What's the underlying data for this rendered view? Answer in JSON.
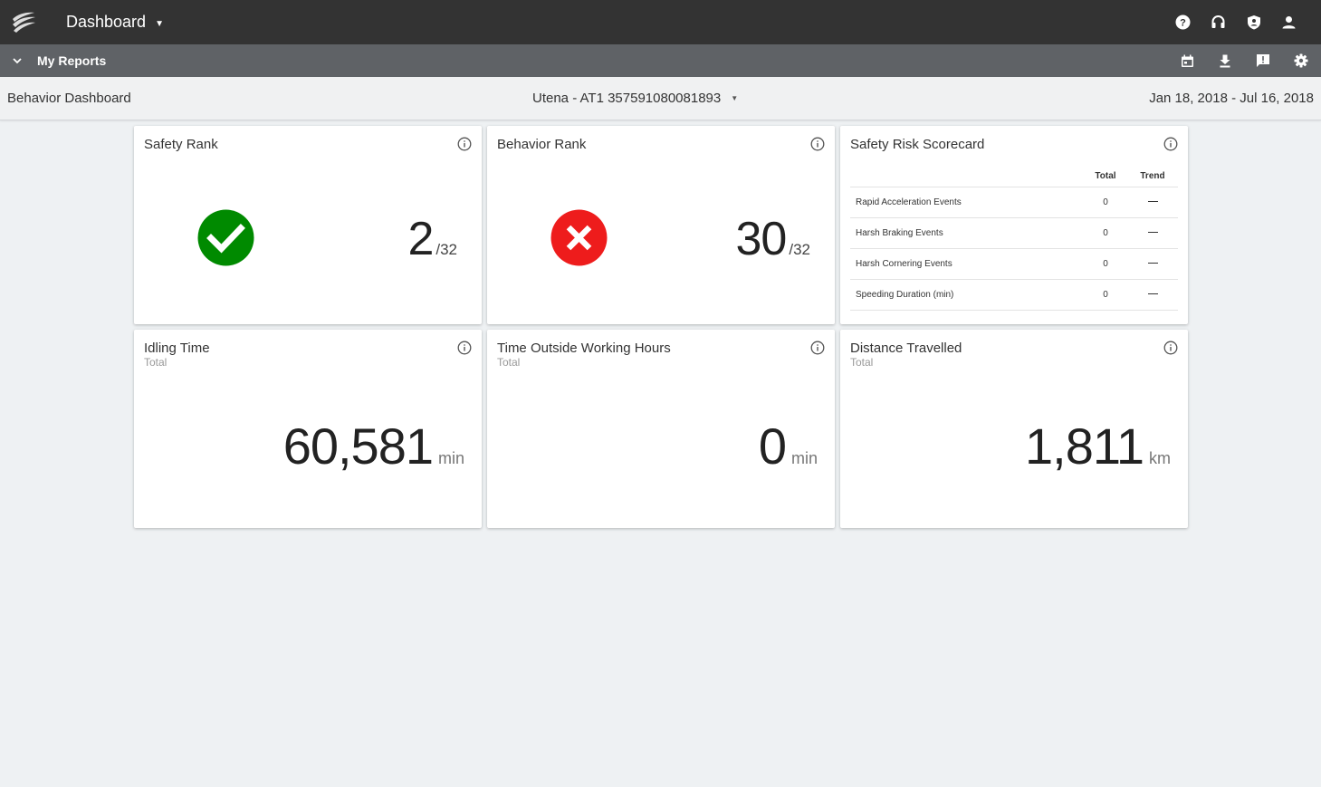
{
  "topbar": {
    "title": "Dashboard",
    "icons": [
      "help-icon",
      "headset-icon",
      "shield-icon",
      "account-icon"
    ]
  },
  "subbar": {
    "reports_label": "My Reports",
    "icons": [
      "calendar-icon",
      "download-icon",
      "feedback-icon",
      "settings-icon"
    ]
  },
  "header": {
    "page_title": "Behavior Dashboard",
    "vehicle": "Utena - AT1 357591080081893",
    "date_range": "Jan 18, 2018 - Jul 16, 2018"
  },
  "cards": {
    "safety_rank": {
      "title": "Safety Rank",
      "value": "2",
      "of": "/32",
      "status": "good",
      "color": "#008a00"
    },
    "behavior_rank": {
      "title": "Behavior Rank",
      "value": "30",
      "of": "/32",
      "status": "bad",
      "color": "#ee1c1c"
    },
    "scorecard": {
      "title": "Safety Risk Scorecard",
      "columns": [
        "Total",
        "Trend"
      ],
      "rows": [
        {
          "label": "Rapid Acceleration Events",
          "total": "0"
        },
        {
          "label": "Harsh Braking Events",
          "total": "0"
        },
        {
          "label": "Harsh Cornering Events",
          "total": "0"
        },
        {
          "label": "Speeding Duration (min)",
          "total": "0"
        }
      ]
    },
    "idling": {
      "title": "Idling Time",
      "sub": "Total",
      "value": "60,581",
      "unit": "min"
    },
    "outside_hours": {
      "title": "Time Outside Working Hours",
      "sub": "Total",
      "value": "0",
      "unit": "min"
    },
    "distance": {
      "title": "Distance Travelled",
      "sub": "Total",
      "value": "1,811",
      "unit": "km"
    }
  }
}
